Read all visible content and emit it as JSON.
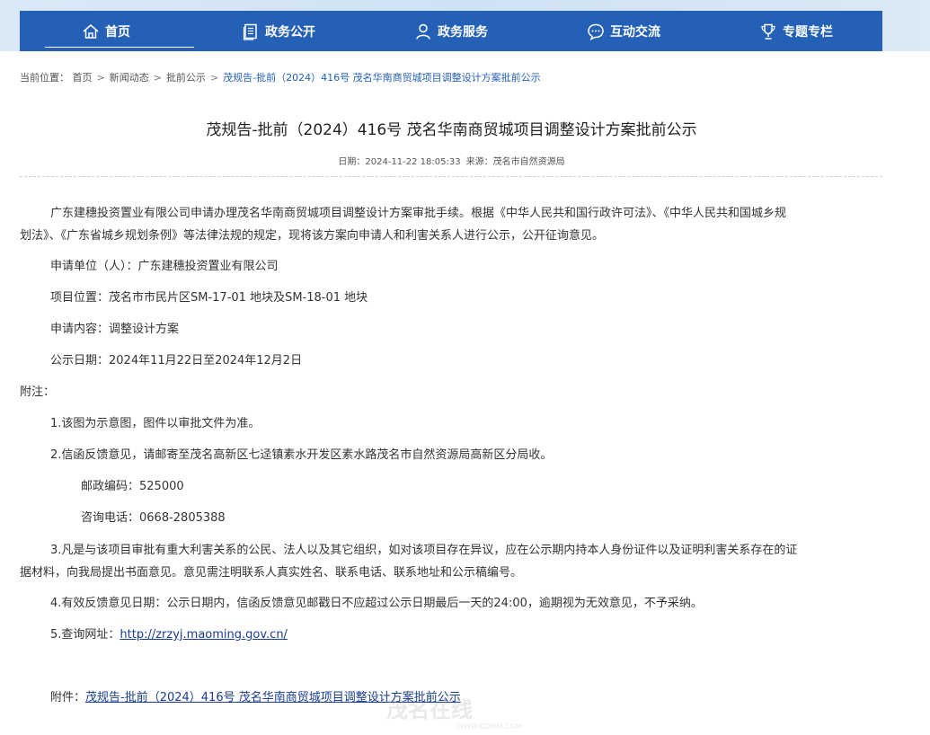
{
  "nav": {
    "items": [
      {
        "label": "首页",
        "icon": "home-icon"
      },
      {
        "label": "政务公开",
        "icon": "document-icon"
      },
      {
        "label": "政务服务",
        "icon": "service-person-icon"
      },
      {
        "label": "互动交流",
        "icon": "chat-bubble-icon"
      },
      {
        "label": "专题专栏",
        "icon": "trophy-icon"
      }
    ]
  },
  "breadcrumb": {
    "prefix": "当前位置：",
    "items": [
      "首页",
      "新闻动态",
      "批前公示"
    ],
    "separator": ">",
    "current": "茂规告-批前（2024）416号 茂名华南商贸城项目调整设计方案批前公示"
  },
  "article": {
    "title": "茂规告-批前（2024）416号 茂名华南商贸城项目调整设计方案批前公示",
    "date_label": "日期：",
    "date": "2024-11-22 18:05:33",
    "source_label": "来源：",
    "source": "茂名市自然资源局",
    "intro_line1": "广东建穗投资置业有限公司申请办理茂名华南商贸城项目调整设计方案审批手续。根据《中华人民共和国行政许可法》、《中华人民共和国城乡规",
    "intro_line2": "划法》、《广东省城乡规划条例》等法律法规的规定，现将该方案向申请人和利害关系人进行公示，公开征询意见。",
    "applicant": "申请单位（人）：广东建穗投资置业有限公司",
    "location": "项目位置：茂名市市民片区SM-17-01 地块及SM-18-01 地块",
    "content": "申请内容：调整设计方案",
    "period": "公示日期：2024年11月22日至2024年12月2日",
    "notes_label": "附注：",
    "note1": "1.该图为示意图，图件以审批文件为准。",
    "note2": "2.信函反馈意见，请邮寄至茂名高新区七迳镇素水开发区素水路茂名市自然资源局高新区分局收。",
    "postcode": "邮政编码：525000",
    "phone": "咨询电话：0668-2805388",
    "note3_line1": "3.凡是与该项目审批有重大利害关系的公民、法人以及其它组织，如对该项目存在异议，应在公示期内持本人身份证件以及证明利害关系存在的证",
    "note3_line2": "据材料，向我局提出书面意见。意见需注明联系人真实姓名、联系电话、联系地址和公示稿编号。",
    "note4": "4.有效反馈意见日期：公示日期内，信函反馈意见邮戳日不应超过公示日期最后一天的24:00，逾期视为无效意见，不予采纳。",
    "note5_label": "5.查询网址：",
    "note5_url": "http://zrzyj.maoming.gov.cn/",
    "attachment_label": "附件：",
    "attachment": "茂规告-批前（2024）416号 茂名华南商贸城项目调整设计方案批前公示"
  },
  "watermark": {
    "text_cn": "茂名在线",
    "text_url": "WWW.GDMM.COM"
  },
  "colors": {
    "nav_bg": "#2360b6",
    "link": "#1a3d8f",
    "breadcrumb_current": "#2360b6"
  }
}
